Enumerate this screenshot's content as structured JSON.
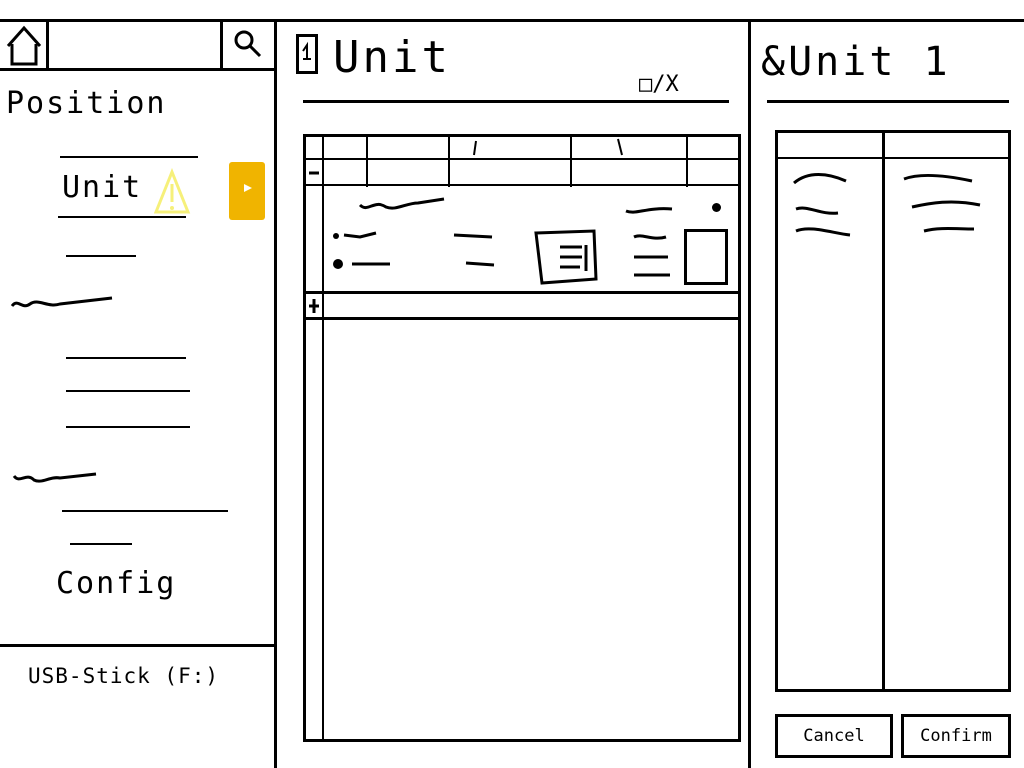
{
  "left_panel": {
    "heading": "Position",
    "selected_item": "Unit",
    "footer_group": "Config",
    "drive": "USB-Stick (F:)"
  },
  "center_panel": {
    "title": "Unit",
    "window_controls": "□/X"
  },
  "right_panel": {
    "title": "&Unit 1",
    "cancel_label": "Cancel",
    "confirm_label": "Confirm"
  },
  "colors": {
    "warning": "#f6f07a",
    "accent": "#f0b400"
  }
}
